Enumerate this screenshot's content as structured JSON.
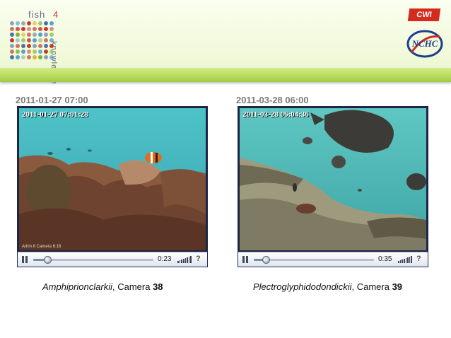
{
  "header": {
    "logo": {
      "word1": "fish",
      "word2": "4",
      "word3": "knowledge"
    },
    "partner1": "CWI",
    "partner2": "NCHC"
  },
  "colors": {
    "header_bg": "#eef8d2",
    "band": "#b8dc5d",
    "date_text": "#7b7b7b",
    "player_border": "#1e2a55"
  },
  "panels": [
    {
      "date_heading": "2011-01-27 07:00",
      "video_timestamp": "2011-01-27 07:01:28",
      "camera_tag": "Arhin 8 Camera 6:16",
      "progress": 0.12,
      "time": "0:23",
      "help": "?",
      "caption": {
        "species": "Amphiprionclarkii",
        "sep": ", Camera ",
        "camera": "38"
      }
    },
    {
      "date_heading": "2011-03-28 06:00",
      "video_timestamp": "2011-03-28 06:04:36",
      "camera_tag": "",
      "progress": 0.1,
      "time": "0:35",
      "help": "?",
      "caption": {
        "species": "Plectroglyphidodondickii",
        "sep": ", Camera ",
        "camera": "39"
      }
    }
  ],
  "icons": [
    "fish4knowledge-logo",
    "cwi-logo",
    "nchc-logo",
    "pause-icon",
    "seek-knob-icon",
    "volume-icon",
    "help-icon"
  ]
}
